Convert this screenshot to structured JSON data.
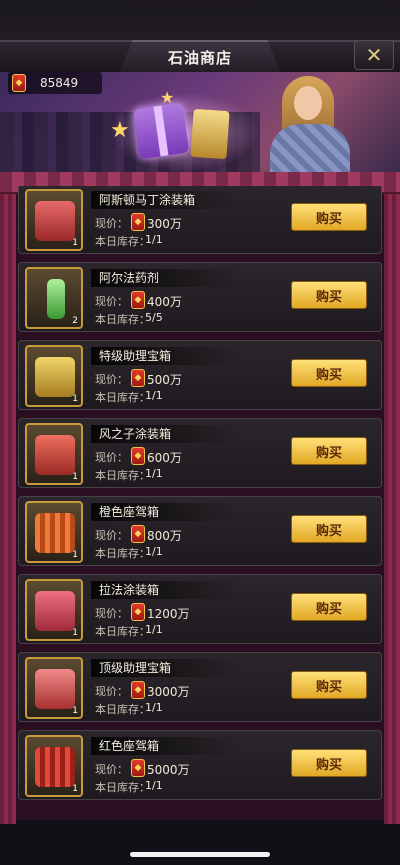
{
  "header": {
    "title": "石油商店",
    "close_glyph": "✕"
  },
  "currency": {
    "icon": "oil-token-icon",
    "value": "85849"
  },
  "labels": {
    "price": "现价：",
    "stock": "本日库存：",
    "buy": "购买"
  },
  "items": [
    {
      "name": "阿斯顿马丁涂装箱",
      "price": "300万",
      "stock": "1/1",
      "qty": "1",
      "box_color": "#c8484a"
    },
    {
      "name": "阿尔法药剂",
      "price": "400万",
      "stock": "5/5",
      "qty": "2",
      "box_color": "#6fd06a"
    },
    {
      "name": "特级助理宝箱",
      "price": "500万",
      "stock": "1/1",
      "qty": "1",
      "box_color": "#d8b23a"
    },
    {
      "name": "风之子涂装箱",
      "price": "600万",
      "stock": "1/1",
      "qty": "1",
      "box_color": "#d04a48"
    },
    {
      "name": "橙色座驾箱",
      "price": "800万",
      "stock": "1/1",
      "qty": "1",
      "box_color": "#d86a34"
    },
    {
      "name": "拉法涂装箱",
      "price": "1200万",
      "stock": "1/1",
      "qty": "1",
      "box_color": "#d84a58"
    },
    {
      "name": "顶级助理宝箱",
      "price": "3000万",
      "stock": "1/1",
      "qty": "1",
      "box_color": "#d85a5a"
    },
    {
      "name": "红色座驾箱",
      "price": "5000万",
      "stock": "1/1",
      "qty": "1",
      "box_color": "#c83a2a"
    }
  ]
}
